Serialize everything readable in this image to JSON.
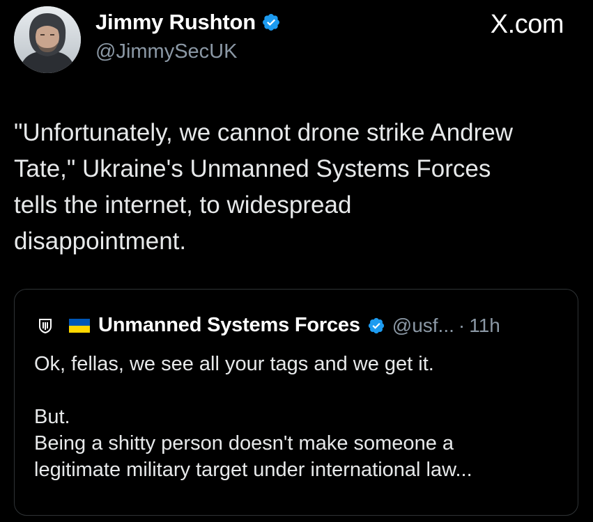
{
  "author": {
    "name": "Jimmy Rushton",
    "handle": "@JimmySecUK",
    "verified": true,
    "avatar_icon": "profile-photo"
  },
  "brand": "X.com",
  "tweet_text_lines": [
    "\"Unfortunately, we cannot drone strike Andrew",
    "Tate,\" Ukraine's Unmanned Systems Forces",
    "tells the internet, to widespread",
    "disappointment."
  ],
  "quote": {
    "logo_icon": "unmanned-systems-forces-emblem",
    "flag": "ukraine-flag",
    "name": "Unmanned Systems Forces",
    "verified": true,
    "handle": "@usf...",
    "separator": "·",
    "time": "11h",
    "text_lines": [
      "Ok, fellas, we see all your tags and we get it.",
      "",
      "But.",
      "Being a shitty person doesn't make someone a",
      "legitimate military target under international law..."
    ]
  },
  "colors": {
    "background": "#000000",
    "text": "#e7e9ea",
    "secondary_text": "#8b98a5",
    "verified_blue": "#1d9bf0",
    "flag_blue": "#0057b7",
    "flag_yellow": "#ffd700",
    "border": "#2f3336"
  }
}
